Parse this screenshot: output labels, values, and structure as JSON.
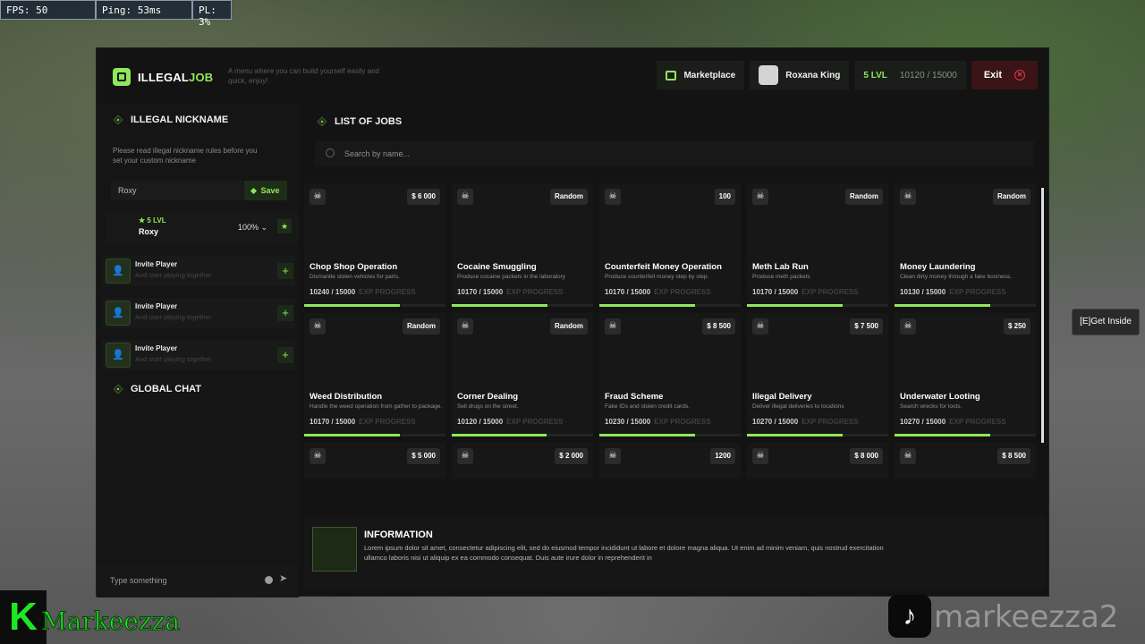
{
  "hud": {
    "fps": "FPS: 50",
    "ping": "Ping: 53ms",
    "pl": "PL: 3%"
  },
  "header": {
    "logo_part1": "ILLEGAL",
    "logo_part2": "JOB",
    "tagline": "A menu where you can build yourself easily and quick, enjoy!",
    "marketplace": "Marketplace",
    "username": "Roxana King",
    "level": "5 LVL",
    "xp": "10120 / 15000",
    "exit": "Exit"
  },
  "sidebar": {
    "nickname_title": "ILLEGAL NICKNAME",
    "nickname_desc": "Please read illegal nickname rules before you set your custom nickname",
    "nickname_value": "Roxy",
    "save_label": "Save",
    "player": {
      "level": "★ 5 LVL",
      "name": "Roxy",
      "percent": "100%"
    },
    "invites": [
      {
        "title": "Invite Player",
        "subtitle": "And start playing together"
      },
      {
        "title": "Invite Player",
        "subtitle": "And start playing together"
      },
      {
        "title": "Invite Player",
        "subtitle": "And start playing together"
      }
    ],
    "chat_title": "GLOBAL CHAT",
    "chat_placeholder": "Type something"
  },
  "main": {
    "jobs_title": "LIST OF JOBS",
    "search_placeholder": "Search by name...",
    "exp_label": "EXP PROGRESS",
    "jobs": [
      {
        "name": "Chop Shop Operation",
        "desc": "Dismantle stolen vehicles for parts.",
        "price": "$ 6 000",
        "xp": "10240 / 15000",
        "progress": 0.68
      },
      {
        "name": "Cocaine Smuggling",
        "desc": "Produce cocaine packets in the laboratory",
        "price": "Random",
        "xp": "10170 / 15000",
        "progress": 0.68
      },
      {
        "name": "Counterfeit Money Operation",
        "desc": "Produce counterfeit money step by step.",
        "price": "100",
        "xp": "10170 / 15000",
        "progress": 0.68
      },
      {
        "name": "Meth Lab Run",
        "desc": "Produce meth packets",
        "price": "Random",
        "xp": "10170 / 15000",
        "progress": 0.68
      },
      {
        "name": "Money Laundering",
        "desc": "Clean dirty money through a fake business.",
        "price": "Random",
        "xp": "10130 / 15000",
        "progress": 0.68
      },
      {
        "name": "Weed Distribution",
        "desc": "Handle the weed operation from gather to package.",
        "price": "Random",
        "xp": "10170 / 15000",
        "progress": 0.68
      },
      {
        "name": "Corner Dealing",
        "desc": "Sell drugs on the street.",
        "price": "Random",
        "xp": "10120 / 15000",
        "progress": 0.67
      },
      {
        "name": "Fraud Scheme",
        "desc": "Fake IDs and stolen credit cards.",
        "price": "$ 8 500",
        "xp": "10230 / 15000",
        "progress": 0.68
      },
      {
        "name": "Illegal Delivery",
        "desc": "Deliver illegal deliveries to locations",
        "price": "$ 7 500",
        "xp": "10270 / 15000",
        "progress": 0.68
      },
      {
        "name": "Underwater Looting",
        "desc": "Search wrecks for loots.",
        "price": "$ 250",
        "xp": "10270 / 15000",
        "progress": 0.68
      },
      {
        "name": "",
        "desc": "",
        "price": "$ 5 000",
        "xp": "",
        "progress": 0
      },
      {
        "name": "",
        "desc": "",
        "price": "$ 2 000",
        "xp": "",
        "progress": 0
      },
      {
        "name": "",
        "desc": "",
        "price": "1200",
        "xp": "",
        "progress": 0
      },
      {
        "name": "",
        "desc": "",
        "price": "$ 8 000",
        "xp": "",
        "progress": 0
      },
      {
        "name": "",
        "desc": "",
        "price": "$ 8 500",
        "xp": "",
        "progress": 0
      }
    ],
    "info_title": "INFORMATION",
    "info_text": "Lorem ipsum dolor sit amet, consectetur adipiscing elit, sed do eiusmod tempor incididunt ut labore et dolore magna aliqua. Ut enim ad minim veniam, quis nostrud exercitation ullamco laboris nisi ut aliquip ex ea commodo consequat. Duis aute irure dolor in reprehenderit in"
  },
  "overlay": {
    "get_inside": "[E]Get Inside",
    "streamer_logo": "K",
    "streamer_name": "Markeezza",
    "tiktok_name": "markeezza2"
  },
  "colors": {
    "accent": "#8fe85a",
    "panel": "#121312",
    "exit_bg": "#3a1417",
    "exit_icon": "#e0384a"
  }
}
